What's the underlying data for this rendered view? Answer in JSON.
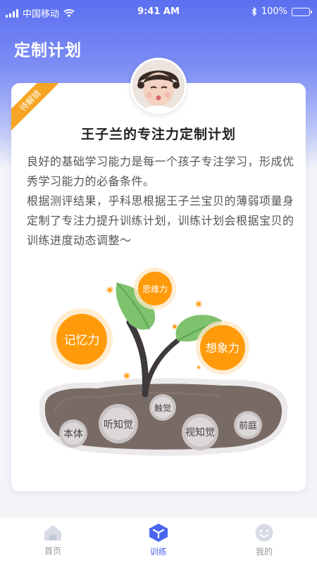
{
  "status_bar": {
    "carrier": "中国移动",
    "time": "9:41 AM",
    "battery": "100%"
  },
  "page_title": "定制计划",
  "card": {
    "ribbon": "待解锁",
    "title": "王子兰的专注力定制计划",
    "paragraphs": [
      "良好的基础学习能力是每一个孩子专注学习，形成优秀学习能力的必备条件。",
      "根据测评结果，乎科思根据王子兰宝贝的薄弱项量身定制了专注力提升训练计划，训练计划会根据宝贝的训练进度动态调整～"
    ]
  },
  "illustration": {
    "bubbles": [
      "思维力",
      "记忆力",
      "想象力"
    ],
    "stones": [
      "本体",
      "听知觉",
      "触觉",
      "视知觉",
      "前庭"
    ]
  },
  "tabbar": {
    "items": [
      {
        "label": "首页",
        "icon": "home-icon"
      },
      {
        "label": "训练",
        "icon": "cube-icon"
      },
      {
        "label": "我的",
        "icon": "smiley-icon"
      }
    ],
    "active": "训练"
  },
  "colors": {
    "header": "#5b6ff0",
    "ribbon": "#f6a623",
    "bubble": "#ff9a0a",
    "tab_active": "#4a66ef"
  }
}
